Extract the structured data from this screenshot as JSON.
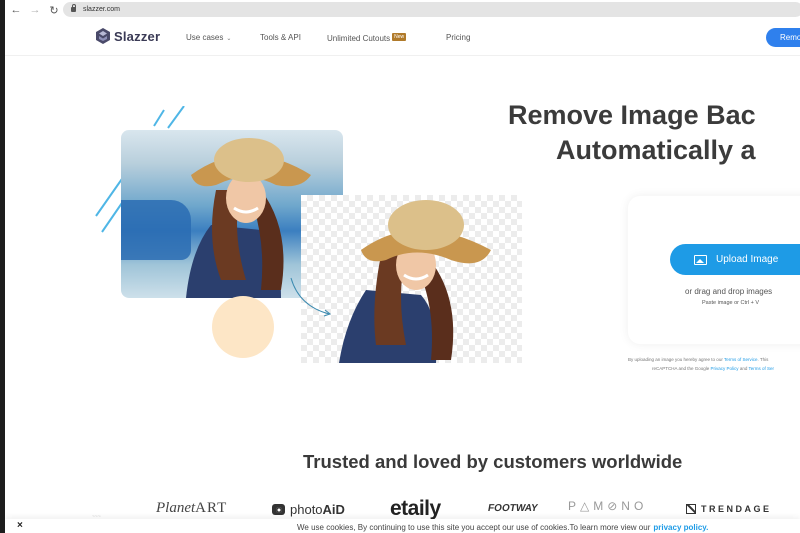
{
  "browser": {
    "url": "slazzer.com",
    "back_icon": "arrow-left-icon",
    "forward_icon": "arrow-right-icon",
    "reload_icon": "reload-icon",
    "lock_icon": "lock-icon"
  },
  "header": {
    "brand": "Slazzer",
    "nav": [
      {
        "label": "Use cases",
        "has_dropdown": true
      },
      {
        "label": "Tools & API"
      },
      {
        "label": "Unlimited Cutouts",
        "badge": "New"
      },
      {
        "label": "Pricing"
      }
    ],
    "cta_label": "Remo"
  },
  "hero": {
    "title_line1": "Remove Image Bac",
    "title_line2": "Automatically a",
    "upload_label": "Upload Image",
    "drag_text": "or drag and drop images",
    "paste_text": "Paste image or Ctrl + V",
    "terms_prefix": "By uploading an image you hereby agree to our",
    "terms_link": "Terms of Service",
    "terms_suffix": ". This",
    "terms_line2_prefix": "reCAPTCHA and the Google",
    "privacy_link": "Privacy Policy",
    "terms_line2_mid": "and",
    "terms_line2_link": "Terms of Ser"
  },
  "trusted": {
    "heading": "Trusted and loved by customers worldwide",
    "brands": [
      "PlanetART",
      "photoAiD",
      "etaily",
      "FOOTWAY",
      "PAMONO",
      "TRENDAGE"
    ]
  },
  "cookie": {
    "close_label": "×",
    "text": "We use cookies, By continuing to use this site you accept our use of cookies.To learn more view our",
    "link": "privacy policy."
  },
  "colors": {
    "primary": "#2f80ed",
    "upload": "#1e9be6",
    "badge": "#b07a2a",
    "heading": "#3b3b3b"
  }
}
